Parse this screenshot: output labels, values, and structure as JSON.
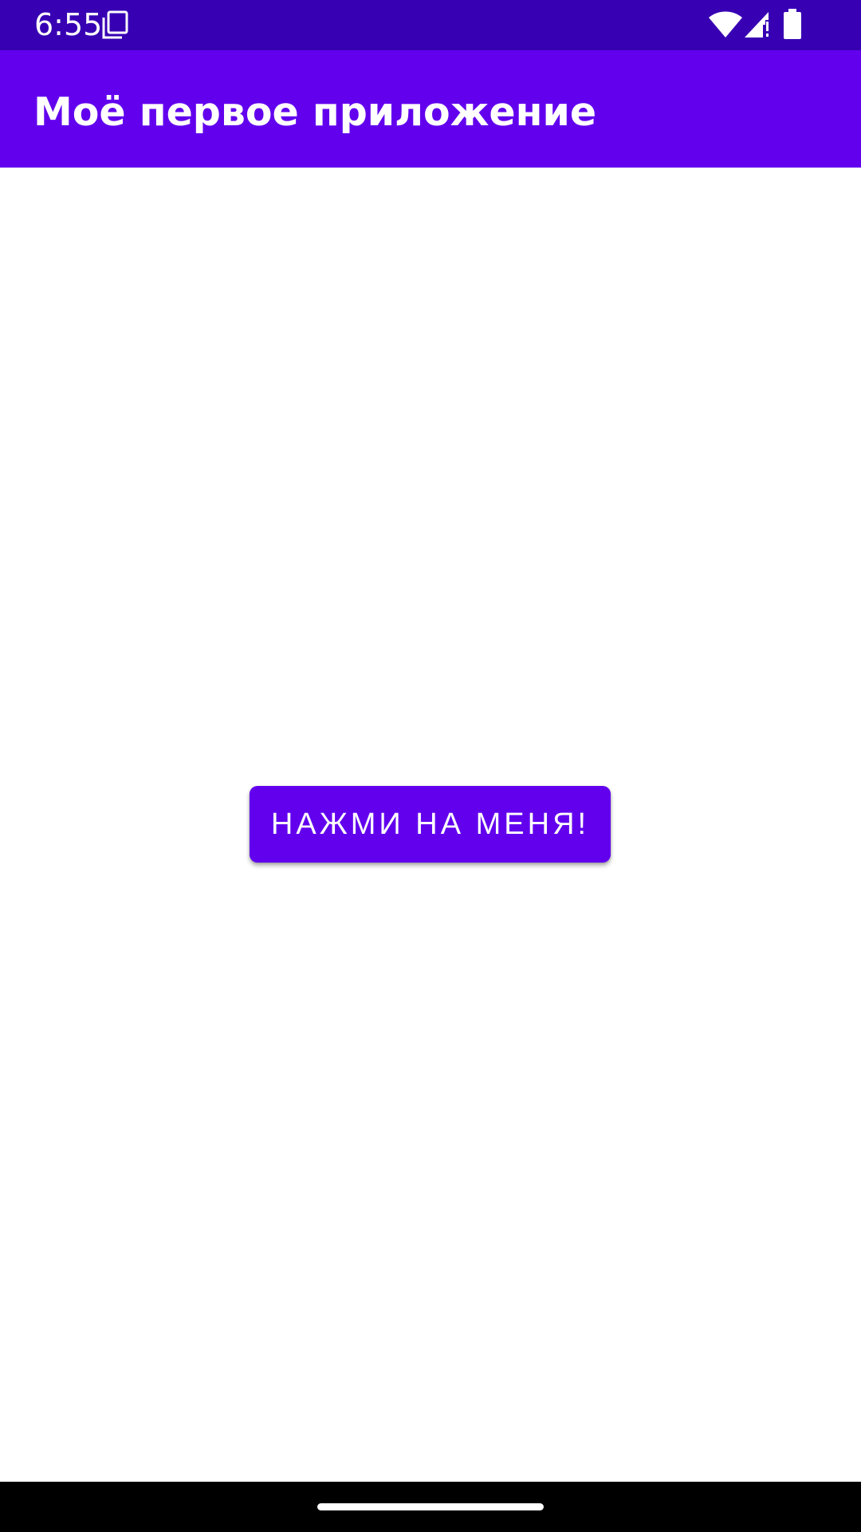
{
  "status_bar": {
    "time": "6:55",
    "background_color": "#3700b3",
    "icons": [
      "copy-icon",
      "wifi-icon",
      "signal-no-data-icon",
      "battery-icon"
    ]
  },
  "app_bar": {
    "title": "Моё первое приложение",
    "background_color": "#6200ee"
  },
  "main": {
    "button_label": "НАЖМИ НА МЕНЯ!",
    "button_color": "#6200ee"
  },
  "nav_bar": {
    "background_color": "#000000",
    "icons": [
      "home-gesture-handle"
    ]
  }
}
